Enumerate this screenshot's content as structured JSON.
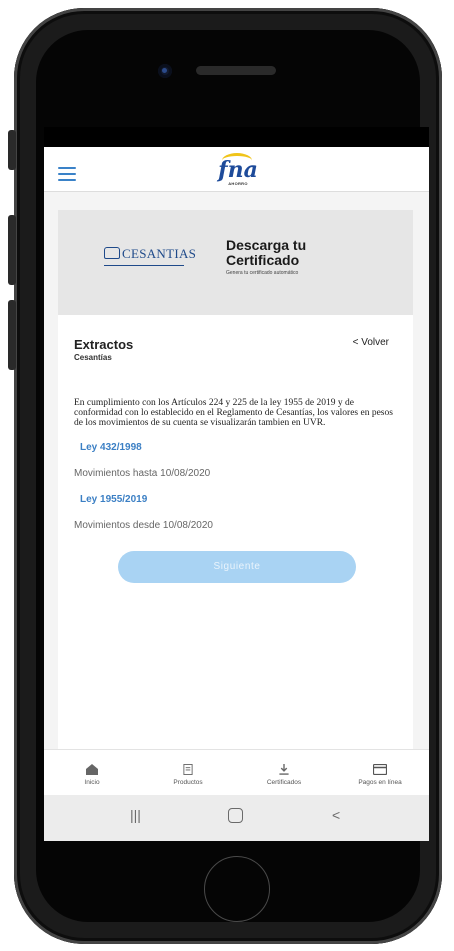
{
  "brand": {
    "logo_text": "fna",
    "logo_sub": "AHORRO"
  },
  "banner": {
    "cesantias_label": "CESANTIAS",
    "title_line1": "Descarga tu",
    "title_line2": "Certificado",
    "subtitle": "Genera tu certificado automático"
  },
  "card": {
    "title": "Extractos",
    "subtitle": "Cesantías",
    "back_label": "< Volver",
    "body": "En cumplimiento con los Artículos 224 y 225 de la ley 1955 de 2019 y de conformidad con lo establecido en el Reglamento de Cesantías, los valores en pesos de los movimientos de su cuenta se visualizarán tambien en UVR.",
    "options": [
      {
        "link": "Ley 432/1998",
        "desc": "Movimientos hasta 10/08/2020"
      },
      {
        "link": "Ley 1955/2019",
        "desc": "Movimientos desde 10/08/2020"
      }
    ],
    "next_label": "Siguiente"
  },
  "tabs": [
    {
      "label": "Inicio",
      "icon": "home-icon"
    },
    {
      "label": "Productos",
      "icon": "document-icon"
    },
    {
      "label": "Certificados",
      "icon": "download-icon"
    },
    {
      "label": "Pagos en línea",
      "icon": "card-icon"
    }
  ],
  "system_nav": {
    "recents": "|||",
    "back": "<"
  },
  "colors": {
    "accent": "#3b7fc4",
    "button": "#a9d3f3",
    "logo": "#1e4b9a",
    "logo_arc": "#f0c419"
  }
}
